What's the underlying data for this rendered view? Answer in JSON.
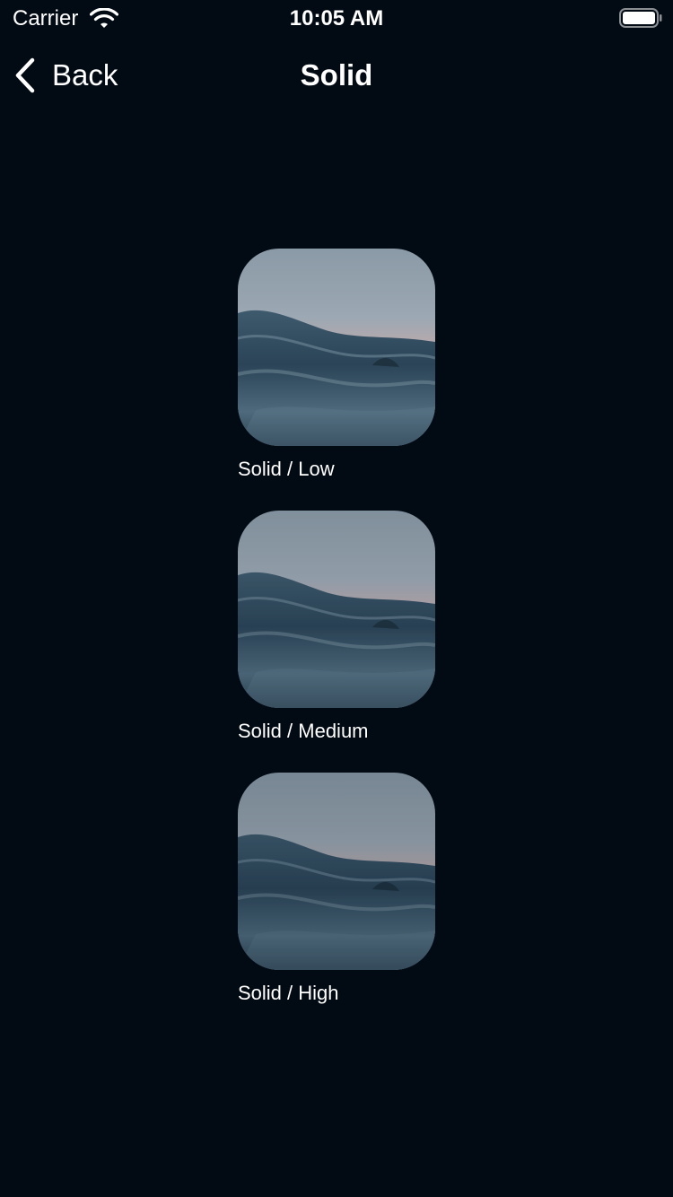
{
  "status_bar": {
    "carrier": "Carrier",
    "time": "10:05 AM"
  },
  "nav": {
    "back_label": "Back",
    "title": "Solid"
  },
  "items": [
    {
      "label": "Solid / Low"
    },
    {
      "label": "Solid / Medium"
    },
    {
      "label": "Solid / High"
    }
  ],
  "colors": {
    "background": "#020a14",
    "text": "#ffffff"
  }
}
